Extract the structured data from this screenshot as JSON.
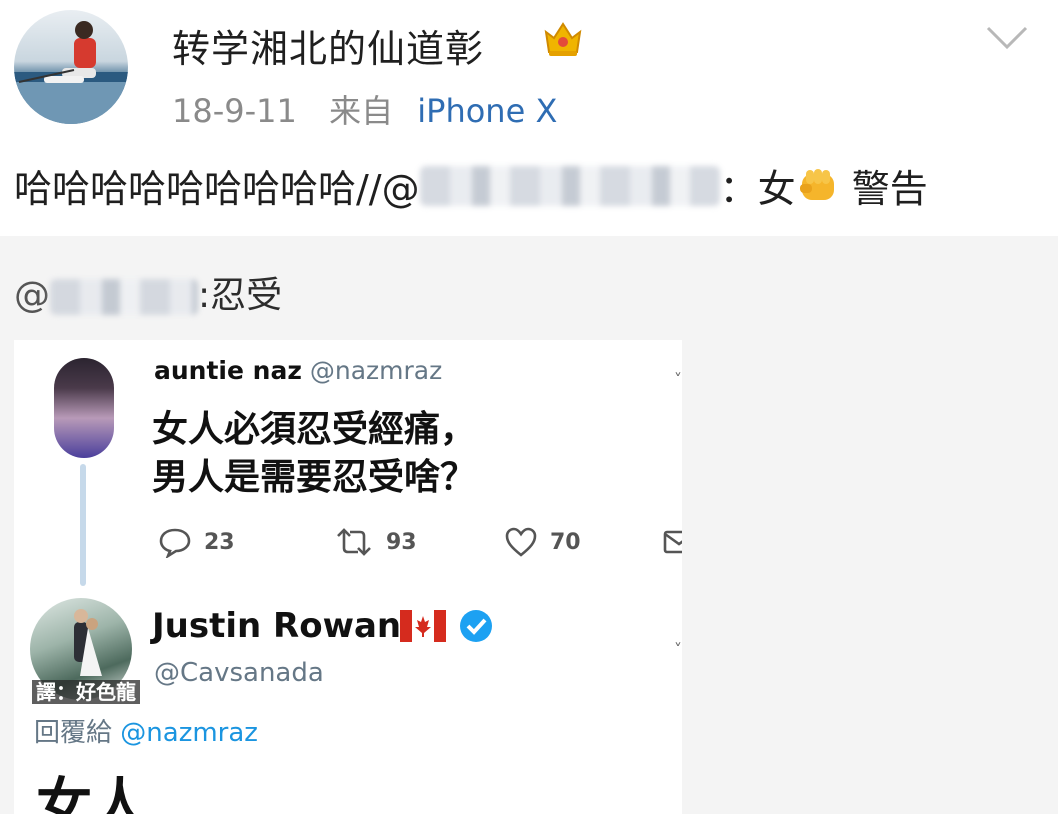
{
  "post": {
    "username": "转学湘北的仙道彰",
    "timestamp": "18-9-11",
    "source_prefix": "来自",
    "source_device": "iPhone X",
    "vip_icon": "crown-vip-icon",
    "menu_icon": "chevron-down-icon",
    "text_before": "哈哈哈哈哈哈哈哈哈//@",
    "text_after_mention": "：女",
    "emoji": "fist-icon",
    "text_end": " 警告"
  },
  "forward": {
    "at_sign": "@",
    "text": ":忍受"
  },
  "tweet1": {
    "display_name": "auntie naz",
    "handle": "@nazmraz",
    "body_line1": "女人必須忍受經痛，",
    "body_line2": "男人是需要忍受啥？",
    "replies": "23",
    "retweets": "93",
    "likes": "70"
  },
  "tweet2": {
    "display_name": "Justin Rowan",
    "handle": "@Cavsanada",
    "translator_watermark": "譯：好色龍",
    "reply_prefix": "回覆給",
    "reply_handle": "@nazmraz",
    "body": "女人"
  },
  "colors": {
    "link_blue": "#2f6db3",
    "meta_gray": "#8a8a8a",
    "twitter_blue": "#1b95e0",
    "forward_bg": "#f4f4f4",
    "vip_gold": "#f0b400"
  }
}
